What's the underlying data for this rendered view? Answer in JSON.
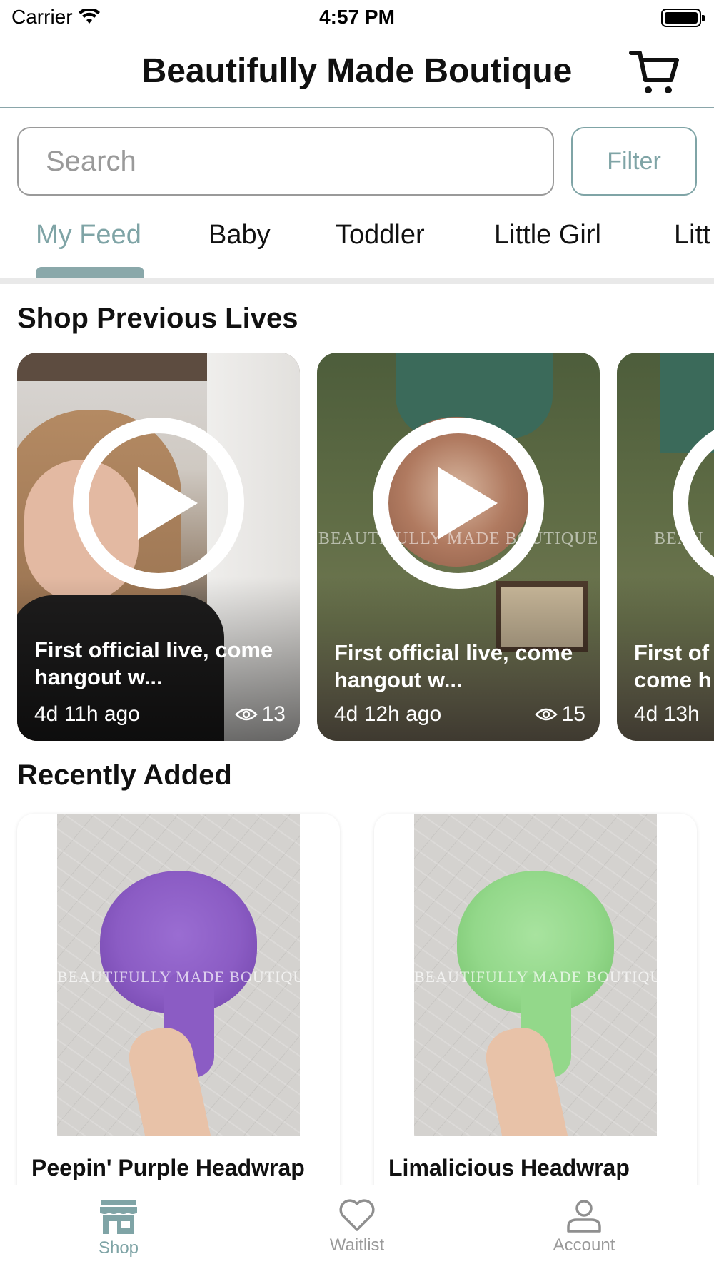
{
  "status_bar": {
    "carrier": "Carrier",
    "time": "4:57 PM"
  },
  "header": {
    "title": "Beautifully Made Boutique",
    "cart_icon": "cart-icon"
  },
  "search": {
    "placeholder": "Search",
    "value": "",
    "filter_label": "Filter"
  },
  "tabs": [
    {
      "label": "My Feed",
      "active": true
    },
    {
      "label": "Baby",
      "active": false
    },
    {
      "label": "Toddler",
      "active": false
    },
    {
      "label": "Little Girl",
      "active": false
    },
    {
      "label": "Litt",
      "active": false
    }
  ],
  "lives": {
    "title": "Shop Previous Lives",
    "items": [
      {
        "title": "First official live, come hangout w...",
        "time": "4d 11h ago",
        "views": "13",
        "watermark": ""
      },
      {
        "title": "First official live, come hangout w...",
        "time": "4d 12h ago",
        "views": "15",
        "watermark": "BEAUTIFULLY MADE BOUTIQUE"
      },
      {
        "title": "First of come h",
        "time": "4d 13h",
        "views": "",
        "watermark": "BEAU"
      }
    ]
  },
  "recent": {
    "title": "Recently Added",
    "products": [
      {
        "name": "Peepin' Purple Headwrap",
        "watermark": "BEAUTIFULLY MADE BOUTIQUE",
        "color": "#8b5cc4"
      },
      {
        "name": "Limalicious Headwrap",
        "watermark": "BEAUTIFULLY MADE BOUTIQUE",
        "color": "#93d88a"
      }
    ]
  },
  "bottom_nav": [
    {
      "label": "Shop",
      "icon": "shop-icon",
      "active": true
    },
    {
      "label": "Waitlist",
      "icon": "heart-icon",
      "active": false
    },
    {
      "label": "Account",
      "icon": "person-icon",
      "active": false
    }
  ],
  "colors": {
    "accent": "#7fa4a6",
    "divider": "#8aa6aa",
    "inactive": "#9a9a9a"
  }
}
